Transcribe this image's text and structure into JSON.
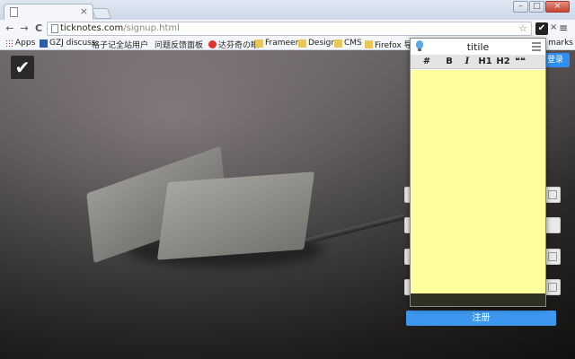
{
  "browser": {
    "tab_close": "×",
    "url_host": "ticknotes.com",
    "url_path": "/signup.html",
    "nav": {
      "back": "←",
      "forward": "→",
      "reload": "C"
    },
    "star": "☆",
    "ext_check": "✔",
    "ext_close": "×",
    "menu": "≡",
    "window": {
      "minimize": "–",
      "maximize": "□",
      "close": "×"
    }
  },
  "bookmarks": {
    "items": [
      {
        "label": "Apps",
        "icon": "apps-icon"
      },
      {
        "label": "GZJ discuss",
        "icon": "bookmark-site-icon"
      },
      {
        "label": "格子记全站用户",
        "icon": "page-icon"
      },
      {
        "label": "问题反馈面板",
        "icon": "page-icon"
      },
      {
        "label": "达芬奇の眼",
        "icon": "pin-icon"
      },
      {
        "label": "Frameer",
        "icon": "folder-icon"
      },
      {
        "label": "Design",
        "icon": "folder-icon"
      },
      {
        "label": "CMS",
        "icon": "folder-icon"
      },
      {
        "label": "Firefox 导入",
        "icon": "folder-icon"
      }
    ],
    "overflow": "marks"
  },
  "page": {
    "logo_mark": "✔",
    "login_label": "登录",
    "submit_label": "注册"
  },
  "popup": {
    "title": "titile",
    "toolbar": {
      "hash": "#",
      "bold": "B",
      "italic": "I",
      "h1": "H1",
      "h2": "H2",
      "quote": "❝❝"
    },
    "note_value": ""
  }
}
